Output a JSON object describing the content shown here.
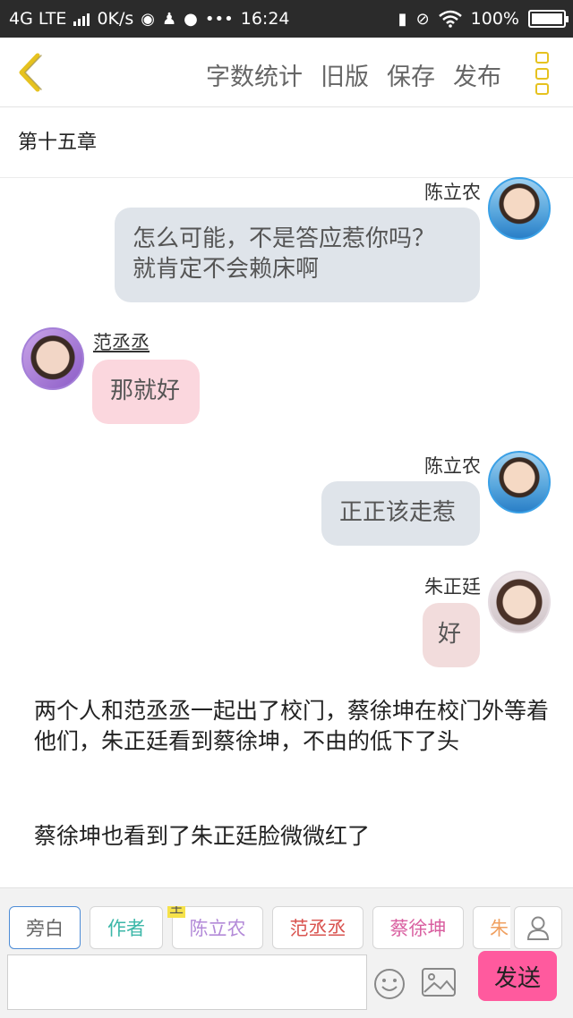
{
  "status_bar": {
    "network": "4G LTE",
    "speed": "0K/s",
    "time": "16:24",
    "battery_percent": "100%",
    "battery_level": 1.0,
    "icons": [
      "signal-icon",
      "weibo-icon",
      "qq-icon",
      "message-icon",
      "more-dots-icon",
      "battery-charging-icon",
      "mute-icon",
      "wifi-icon",
      "battery-icon"
    ]
  },
  "toolbar": {
    "word_count_label": "字数统计",
    "old_version_label": "旧版",
    "save_label": "保存",
    "publish_label": "发布"
  },
  "chapter": {
    "title": "第十五章"
  },
  "messages": [
    {
      "speaker": "陈立农",
      "side": "right",
      "lines": [
        "怎么可能，不是答应惹你吗？",
        "就肯定不会赖床啊"
      ]
    },
    {
      "speaker": "范丞丞",
      "side": "left",
      "lines": [
        "那就好"
      ]
    },
    {
      "speaker": "陈立农",
      "side": "right",
      "lines": [
        "正正该走惹"
      ]
    },
    {
      "speaker": "朱正廷",
      "side": "right",
      "lines": [
        "好"
      ]
    }
  ],
  "narration": [
    "两个人和范丞丞一起出了校门，蔡徐坤在校门外等着他们，朱正廷看到蔡徐坤，不由的低下了头",
    "蔡徐坤也看到了朱正廷脸微微红了"
  ],
  "roles": {
    "main_tag": "主",
    "items": [
      "旁白",
      "作者",
      "陈立农",
      "范丞丞",
      "蔡徐坤",
      "朱"
    ]
  },
  "composer": {
    "input_value": "",
    "send_label": "发送"
  },
  "colors": {
    "accent_yellow": "#e6c21f",
    "send_pink": "#ff5a9e",
    "bubble_blue": "#dfe4ea",
    "bubble_pink": "#fbd7de"
  }
}
